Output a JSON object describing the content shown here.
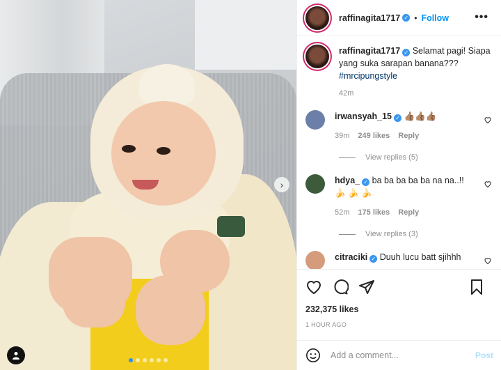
{
  "post": {
    "username": "raffinagita1717",
    "follow_label": "Follow",
    "separator": "•",
    "more_label": "•••"
  },
  "caption": {
    "username": "raffinagita1717",
    "text": "Selamat pagi! Siapa yang suka sarapan banana???",
    "hashtag": "#mrcipungstyle",
    "time": "42m"
  },
  "comments": [
    {
      "username": "irwansyah_15",
      "text": "👍🏽👍🏽👍🏽",
      "time": "39m",
      "likes": "249 likes",
      "reply_label": "Reply",
      "view_replies": "View replies (5)",
      "avatar_color": "#6b7fa8"
    },
    {
      "username": "hdya_",
      "text": "ba ba ba ba ba na na..!! 🍌 🍌 🍌",
      "time": "52m",
      "likes": "175 likes",
      "reply_label": "Reply",
      "view_replies": "View replies (3)",
      "avatar_color": "#3d5a3a"
    },
    {
      "username": "citraciki",
      "text": "Duuh lucu batt sjihhh",
      "avatar_color": "#d49c7c"
    }
  ],
  "engagement": {
    "likes": "232,375 likes",
    "posted": "1 HOUR AGO"
  },
  "comment_box": {
    "placeholder": "Add a comment...",
    "post_label": "Post"
  },
  "icons": {
    "verified": "verified-badge",
    "like": "heart-icon",
    "comment": "comment-icon",
    "share": "share-icon",
    "save": "bookmark-icon",
    "emoji": "emoji-icon",
    "next": "chevron-right-icon",
    "user_tag": "user-tag-icon"
  },
  "carousel": {
    "total": 6,
    "active": 1
  },
  "colors": {
    "accent": "#0095f6",
    "verified": "#3897f0",
    "hashtag": "#00376b",
    "muted": "#8e8e8e",
    "post_disabled": "#b2dffc",
    "story_ring": "#d02a6a"
  }
}
